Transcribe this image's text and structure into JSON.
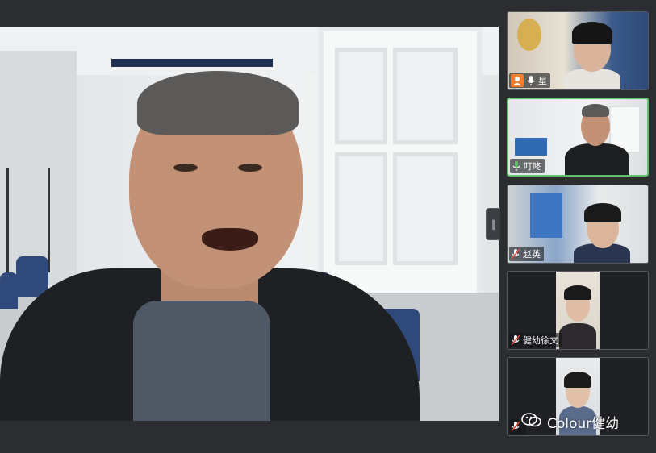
{
  "main_video": {
    "speaker": "active-speaker"
  },
  "panel_toggle": {
    "icon": "collapse-handle-icon"
  },
  "participants": [
    {
      "name": "星",
      "mic": "mic-on-icon",
      "host": true
    },
    {
      "name": "叮咚",
      "mic": "mic-active-icon",
      "host": false,
      "active": true
    },
    {
      "name": "赵英",
      "mic": "mic-muted-icon",
      "host": false
    },
    {
      "name": "健幼徐文",
      "mic": "mic-muted-icon",
      "host": false
    },
    {
      "name": "",
      "mic": "mic-muted-icon",
      "host": false
    }
  ],
  "watermark": {
    "text": "Colour健幼",
    "icon": "wechat-icon"
  },
  "colors": {
    "background": "#2b2d30",
    "active_border": "#5fbf6a",
    "host_badge": "#f07f2e",
    "muted_red": "#e04a3f"
  }
}
